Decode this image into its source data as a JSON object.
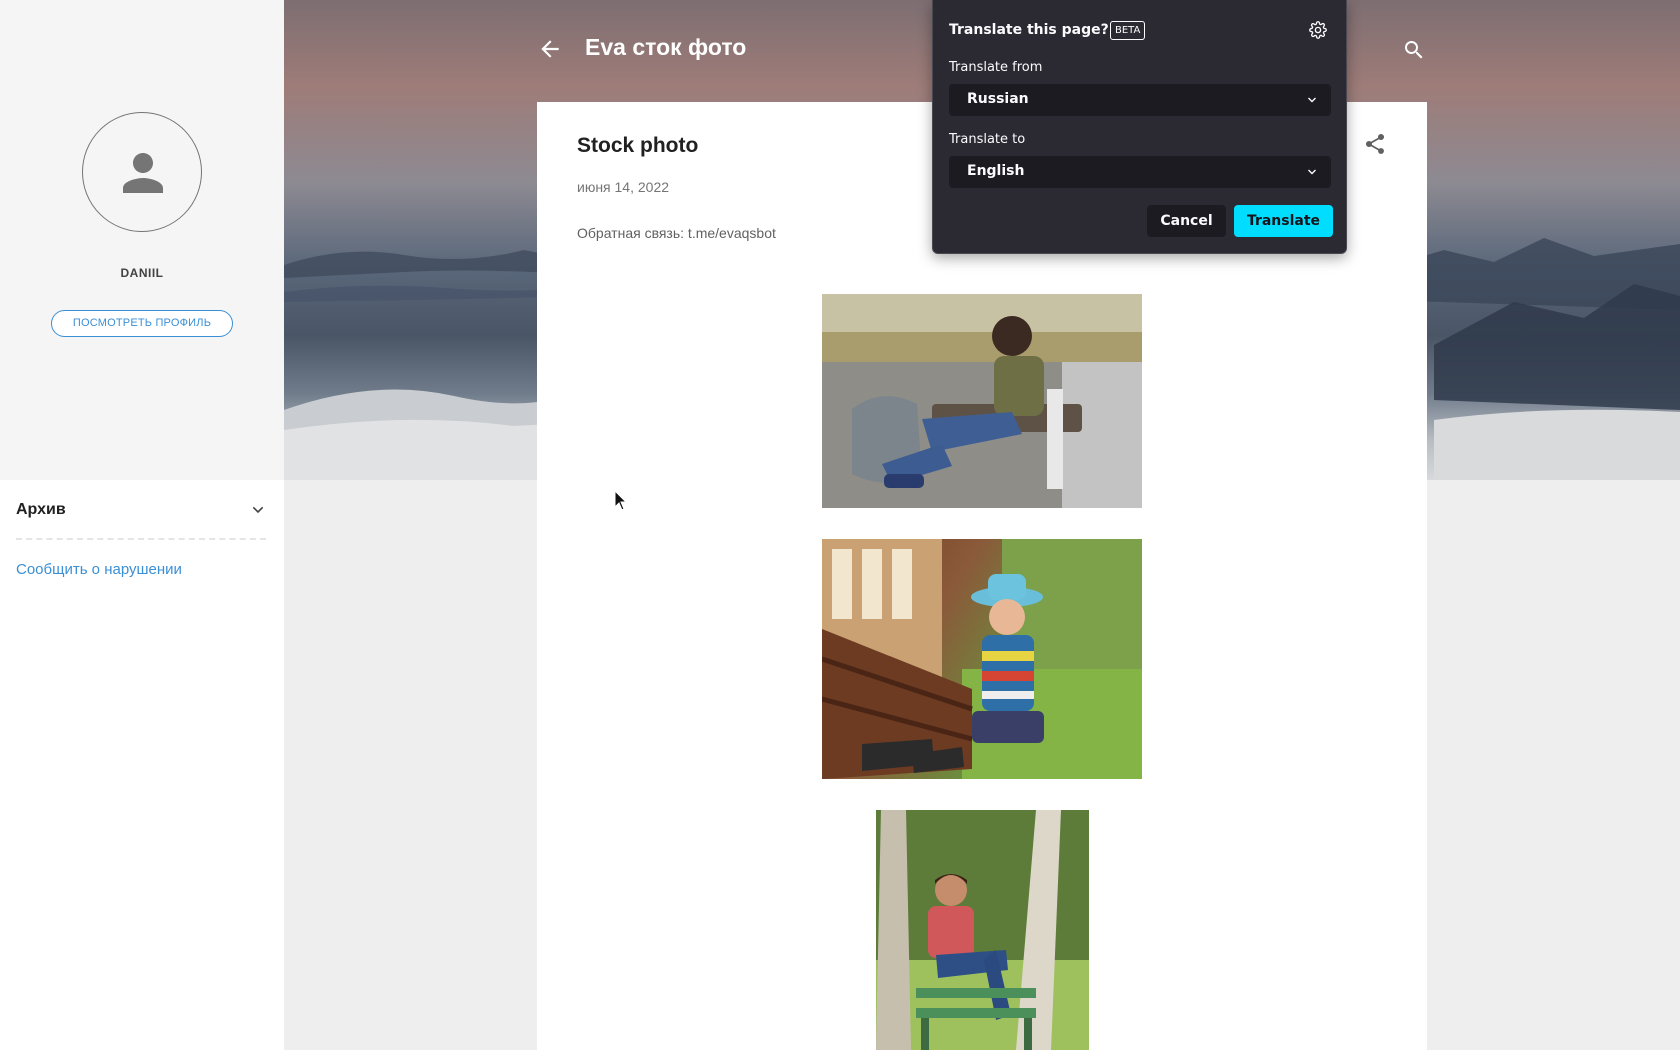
{
  "header": {
    "blog_title": "Eva сток фото"
  },
  "sidebar": {
    "profile_name": "DANIIL",
    "profile_button": "ПОСМОТРЕТЬ ПРОФИЛЬ",
    "archive_label": "Архив",
    "report_link": "Сообщить о нарушении"
  },
  "post": {
    "title": "Stock photo",
    "date": "июня 14, 2022",
    "feedback": "Обратная связь: t.me/evaqsbot"
  },
  "translate_popup": {
    "title": "Translate this page?",
    "badge": "BETA",
    "from_label": "Translate from",
    "from_value": "Russian",
    "to_label": "Translate to",
    "to_value": "English",
    "cancel_label": "Cancel",
    "translate_label": "Translate",
    "accent_color": "#00ddff"
  }
}
